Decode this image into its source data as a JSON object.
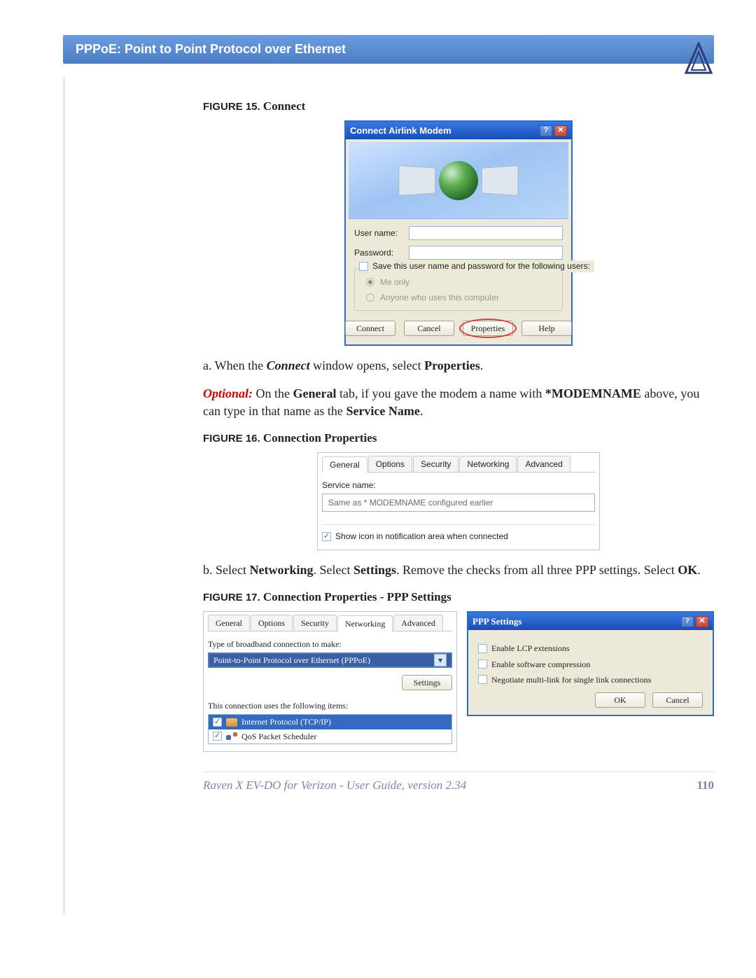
{
  "header": {
    "title": "PPPoE: Point to Point Protocol over Ethernet"
  },
  "figures": {
    "fig15": {
      "prefix": "FIGURE 15.",
      "title": "Connect"
    },
    "fig16": {
      "prefix": "FIGURE 16.",
      "title": "Connection Properties"
    },
    "fig17": {
      "prefix": "FIGURE 17.",
      "title": "Connection Properties - PPP Settings"
    }
  },
  "connect_dialog": {
    "title": "Connect Airlink Modem",
    "username_label": "User name:",
    "password_label": "Password:",
    "save_label": "Save this user name and password for the following users:",
    "radio_me": "Me only",
    "radio_anyone": "Anyone who uses this computer",
    "btn_connect": "Connect",
    "btn_cancel": "Cancel",
    "btn_properties": "Properties",
    "btn_help": "Help"
  },
  "body": {
    "step_a_pre": "a. When the ",
    "step_a_connect": "Connect",
    "step_a_mid": " window opens, select ",
    "step_a_props": "Properties",
    "step_a_end": ".",
    "optional_label": "Optional:",
    "optional_pre": " On the ",
    "optional_general": "General",
    "optional_mid1": " tab, if you gave the modem a name with ",
    "optional_modemname": "*MODEMNAME",
    "optional_mid2": " above, you can type in that name as the ",
    "optional_servicename": "Service Name",
    "optional_end": ".",
    "step_b_pre": "b. Select ",
    "step_b_networking": "Networking",
    "step_b_mid1": ".  Select ",
    "step_b_settings": "Settings",
    "step_b_mid2": ".  Remove the checks from all three PPP settings.  Select ",
    "step_b_ok": "OK",
    "step_b_end": "."
  },
  "props_general": {
    "tabs": {
      "general": "General",
      "options": "Options",
      "security": "Security",
      "networking": "Networking",
      "advanced": "Advanced"
    },
    "service_name_label": "Service name:",
    "service_name_value": "Same as * MODEMNAME configured earlier",
    "show_icon": "Show icon in notification area when connected"
  },
  "networking_panel": {
    "type_label": "Type of broadband connection to make:",
    "dropdown_value": "Point-to-Point Protocol over Ethernet (PPPoE)",
    "settings_btn": "Settings",
    "uses_label": "This connection uses the following items:",
    "item_ip": "Internet Protocol (TCP/IP)",
    "item_qos": "QoS Packet Scheduler"
  },
  "ppp_settings": {
    "title": "PPP Settings",
    "opt1": "Enable LCP extensions",
    "opt2": "Enable software compression",
    "opt3": "Negotiate multi-link for single link connections",
    "btn_ok": "OK",
    "btn_cancel": "Cancel"
  },
  "footer": {
    "doc": "Raven X EV-DO for Verizon - User Guide, version 2.34",
    "page": "110"
  }
}
